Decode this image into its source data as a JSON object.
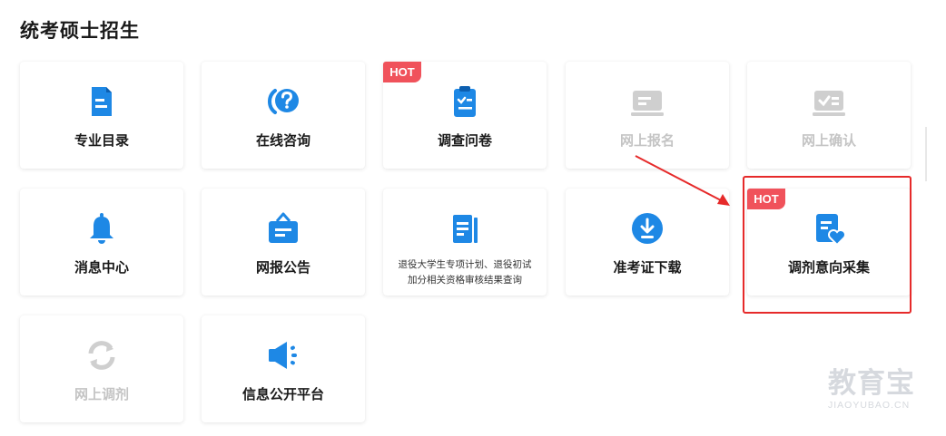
{
  "section": {
    "title": "统考硕士招生"
  },
  "colors": {
    "accent": "#1e88e5",
    "disabled": "#c4c4c4",
    "hot_badge": "#f0525b",
    "highlight": "#e62a2a"
  },
  "cards": [
    {
      "label": "专业目录",
      "icon": "catalog-icon",
      "enabled": true,
      "hot": false
    },
    {
      "label": "在线咨询",
      "icon": "consult-icon",
      "enabled": true,
      "hot": false
    },
    {
      "label": "调查问卷",
      "icon": "clipboard-icon",
      "enabled": true,
      "hot": true,
      "hot_label": "HOT"
    },
    {
      "label": "网上报名",
      "icon": "register-icon",
      "enabled": false,
      "hot": false
    },
    {
      "label": "网上确认",
      "icon": "confirm-icon",
      "enabled": false,
      "hot": false
    },
    {
      "label": "消息中心",
      "icon": "bell-icon",
      "enabled": true,
      "hot": false
    },
    {
      "label": "网报公告",
      "icon": "announcement-icon",
      "enabled": true,
      "hot": false
    },
    {
      "label_lines": [
        "退役大学生专项计划、退役初试",
        "加分相关资格审核结果查询"
      ],
      "icon": "document-icon",
      "enabled": true,
      "hot": false
    },
    {
      "label": "准考证下载",
      "icon": "download-icon",
      "enabled": true,
      "hot": false
    },
    {
      "label": "调剂意向采集",
      "icon": "form-heart-icon",
      "enabled": true,
      "hot": true,
      "hot_label": "HOT",
      "highlighted": true
    },
    {
      "label": "网上调剂",
      "icon": "refresh-icon",
      "enabled": false,
      "hot": false
    },
    {
      "label": "信息公开平台",
      "icon": "speaker-icon",
      "enabled": true,
      "hot": false
    }
  ],
  "watermark": {
    "cn": "教育宝",
    "en": "JIAOYUBAO.CN"
  }
}
